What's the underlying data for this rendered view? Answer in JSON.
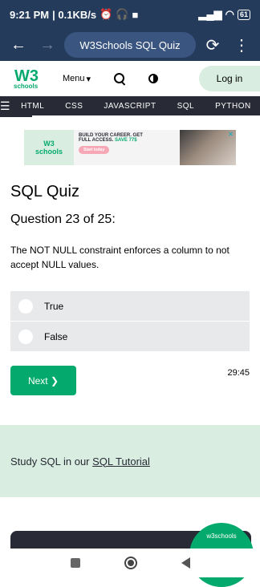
{
  "statusbar": {
    "time": "9:21 PM",
    "speed": "| 0.1KB/s",
    "battery": "61"
  },
  "browser": {
    "back_icon": "arrow-left-icon",
    "forward_icon": "arrow-right-icon",
    "url_title": "W3Schools SQL Quiz",
    "reload_icon": "reload-icon",
    "more_icon": "more-vertical-icon"
  },
  "header": {
    "logo_mark": "W3",
    "logo_text": "schools",
    "menu_label": "Menu",
    "login_label": "Log in"
  },
  "topnav": {
    "items": [
      "HTML",
      "CSS",
      "JAVASCRIPT",
      "SQL",
      "PYTHON"
    ]
  },
  "ad": {
    "line1": "BUILD YOUR CAREER. GET",
    "line2": "FULL ACCESS.",
    "save": "SAVE 77$",
    "cta": "Start today"
  },
  "quiz": {
    "title": "SQL Quiz",
    "question_number": "Question 23 of 25:",
    "question_text": "The NOT NULL constraint enforces a column to not accept NULL values.",
    "options": [
      "True",
      "False"
    ],
    "next_label": "Next ❯",
    "timer": "29:45"
  },
  "study": {
    "prefix": "Study SQL in our ",
    "link": "SQL Tutorial"
  },
  "fab": {
    "label": "w3schools"
  }
}
